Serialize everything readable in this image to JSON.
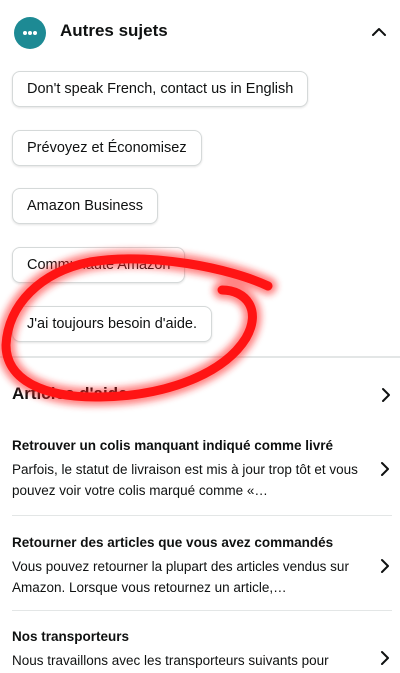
{
  "header": {
    "title": "Autres sujets"
  },
  "topics": [
    {
      "label": "Don't speak French, contact us in English"
    },
    {
      "label": "Prévoyez et Économisez"
    },
    {
      "label": "Amazon Business"
    },
    {
      "label": "Communauté Amazon"
    },
    {
      "label": "J'ai toujours besoin d'aide."
    }
  ],
  "help_articles": {
    "title": "Articles d'aide",
    "items": [
      {
        "title": "Retrouver un colis manquant indiqué comme livré",
        "description": "Parfois, le statut de livraison est mis à jour trop tôt et vous pouvez voir votre colis marqué comme «…"
      },
      {
        "title": "Retourner des articles que vous avez commandés",
        "description": "Vous pouvez retourner la plupart des articles vendus sur Amazon. Lorsque vous retournez un article,…"
      },
      {
        "title": "Nos transporteurs",
        "description": "Nous travaillons avec les transporteurs suivants pour"
      }
    ]
  },
  "colors": {
    "accent": "#1d8a94",
    "annotation": "#ff1a1a"
  }
}
